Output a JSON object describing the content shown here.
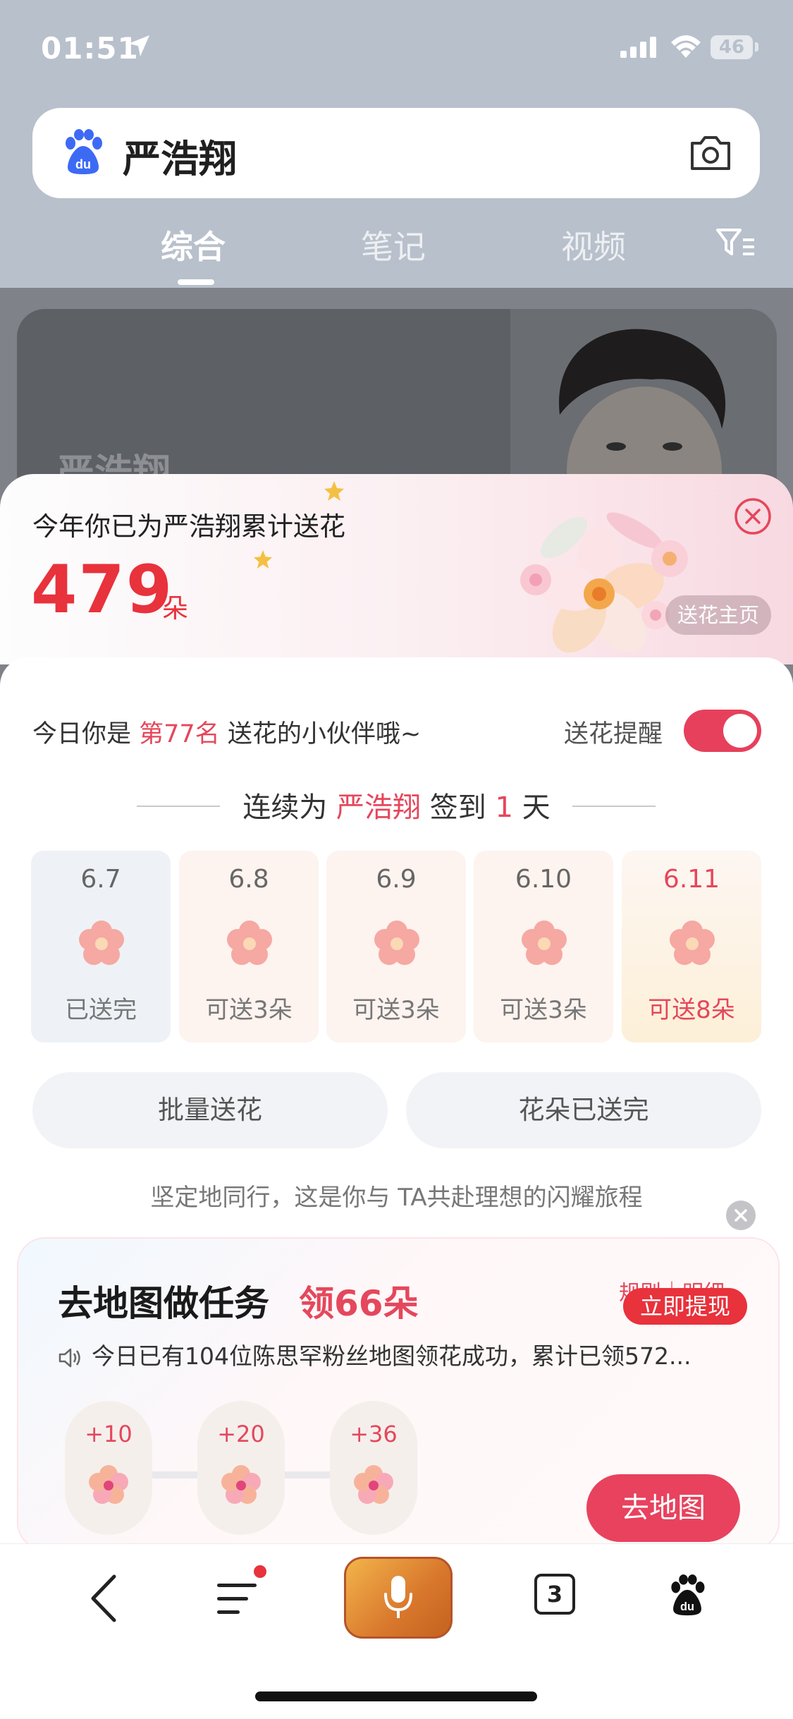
{
  "status_bar": {
    "time": "01:51",
    "battery": "46"
  },
  "search": {
    "query": "严浩翔"
  },
  "tabs": [
    {
      "label": "综合",
      "active": true
    },
    {
      "label": "笔记",
      "active": false
    },
    {
      "label": "视频",
      "active": false
    }
  ],
  "background_card": {
    "name": "严浩翔"
  },
  "popup": {
    "title": "今年你已为严浩翔累计送花",
    "count": "479",
    "unit": "朵",
    "home_button": "送花主页",
    "rank_prefix": "今日你是",
    "rank_value": "第77名",
    "rank_suffix": "送花的小伙伴哦~",
    "reminder_label": "送花提醒",
    "reminder_on": true,
    "streak_prefix": "连续为",
    "streak_name": "严浩翔",
    "streak_middle": "签到",
    "streak_days": "1",
    "streak_suffix": "天",
    "days": [
      {
        "date": "6.7",
        "status": "已送完"
      },
      {
        "date": "6.8",
        "status": "可送3朵"
      },
      {
        "date": "6.9",
        "status": "可送3朵"
      },
      {
        "date": "6.10",
        "status": "可送3朵"
      },
      {
        "date": "6.11",
        "status": "可送8朵"
      }
    ],
    "batch_button": "批量送花",
    "done_button": "花朵已送完",
    "slogan": "坚定地同行，这是你与 TA共赴理想的闪耀旅程"
  },
  "task_card": {
    "title": "去地图做任务",
    "reward": "领66朵",
    "rules_link": "规则｜明细",
    "withdraw_badge": "立即提现",
    "notice": "今日已有104位陈思罕粉丝地图领花成功，累计已领572...",
    "steps": [
      "+10",
      "+20",
      "+36"
    ],
    "go_button": "去地图"
  },
  "bottom_nav": {
    "tab_count": "3"
  },
  "colors": {
    "accent": "#e8323c",
    "pink": "#e5475c",
    "toggle": "#e6405c"
  }
}
